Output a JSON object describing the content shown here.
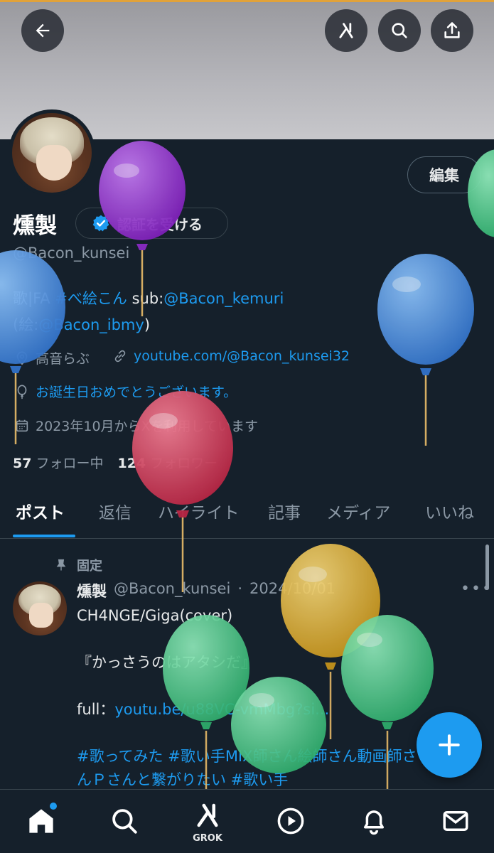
{
  "colors": {
    "background": "#15202b",
    "accent": "#1d9bf0",
    "secondary_text": "#8b98a5",
    "balloon_purple": "#9b35d6",
    "balloon_blue": "#4a90e2",
    "balloon_red": "#d8405a",
    "balloon_yellow": "#e6b83a",
    "balloon_green": "#4fd08f"
  },
  "header": {
    "back_icon": "arrow-left-icon",
    "grok_icon": "grok-icon",
    "search_icon": "search-icon",
    "share_icon": "share-icon"
  },
  "profile": {
    "edit_label": "編集",
    "name": "燻製",
    "verify_label": "認証を受ける",
    "handle": "@Bacon_kunsei",
    "bio_prefix": "歌|FA",
    "bio_hashtag": "#べ絵こん",
    "bio_sub_prefix": "sub:",
    "bio_sub_link": "@Bacon_kemuri",
    "bio_line2_prefix": "(絵:",
    "bio_line2_link": "@Bacon_ibmy",
    "bio_line2_suffix": ")",
    "location": "高音らぶ",
    "website": "youtube.com/@Bacon_kunsei32",
    "birthday_text": "お誕生日おめでとうございます。",
    "joined": "2023年10月からXを利用しています",
    "following_count": "57",
    "following_label": "フォロー中",
    "followers_count": "124",
    "followers_label": "フォロワー"
  },
  "tabs": [
    "ポスト",
    "返信",
    "ハイライト",
    "記事",
    "メディア",
    "いいね"
  ],
  "post": {
    "pinned_label": "固定",
    "author_name": "燻製",
    "author_handle": "@Bacon_kunsei",
    "separator": "·",
    "date": "2024/10/01",
    "line1": "CH4NGE/Giga(cover)",
    "line2": "『かっさうのはアタシだ』",
    "full_prefix": "full：",
    "full_link": "youtu.be/u88VC-vmMbg?si...",
    "hashtags_line1": "#歌ってみた #歌い手MIX師さん絵師さん動画師さ",
    "hashtags_line2": "んＰさんと繋がりたい #歌い手"
  },
  "fab_icon": "plus-icon",
  "bottom_nav": {
    "home_icon": "home-icon",
    "search_icon": "search-icon",
    "grok_label": "GROK",
    "video_icon": "play-icon",
    "notifications_icon": "bell-icon",
    "messages_icon": "mail-icon"
  }
}
